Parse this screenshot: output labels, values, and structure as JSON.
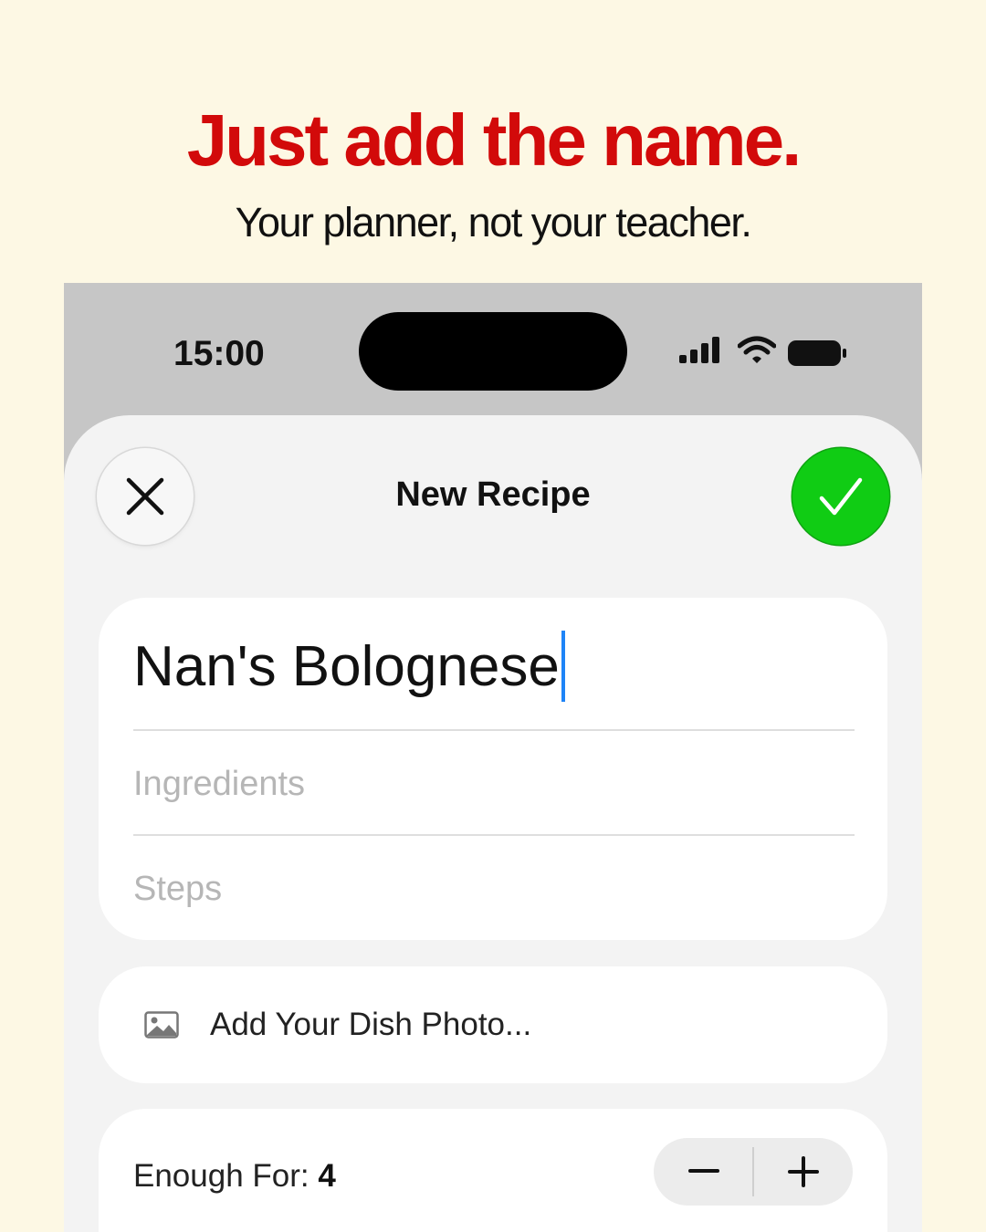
{
  "headline": "Just add the name.",
  "subheadline": "Your planner, not your teacher.",
  "status_bar": {
    "time": "15:00",
    "icons": [
      "cellular-signal-icon",
      "wifi-icon",
      "battery-icon"
    ]
  },
  "sheet": {
    "title": "New Recipe",
    "close_icon": "close-icon",
    "done_icon": "checkmark-icon"
  },
  "form": {
    "name_value": "Nan's Bolognese",
    "ingredients_placeholder": "Ingredients",
    "steps_placeholder": "Steps"
  },
  "photo": {
    "icon": "photo-icon",
    "label": "Add Your Dish Photo..."
  },
  "servings": {
    "label": "Enough For: ",
    "value": "4",
    "decrement_icon": "minus-icon",
    "increment_icon": "plus-icon"
  },
  "colors": {
    "background": "#fdf8e4",
    "headline": "#d20a0a",
    "done_button": "#10cc14",
    "caret": "#1e84f7"
  }
}
